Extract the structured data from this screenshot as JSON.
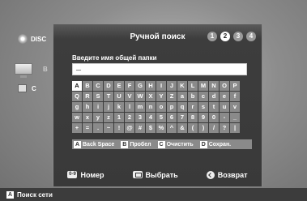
{
  "background": {
    "disc_label": "DISC",
    "pc_letter": "B",
    "item3_letter": "C"
  },
  "dialog": {
    "title": "Ручной поиск",
    "steps": [
      "1",
      "2",
      "3",
      "4"
    ],
    "active_step": "2",
    "prompt": "Введите имя общей папки",
    "input_value": "_",
    "selected_key": "A",
    "keyboard_rows": [
      [
        "A",
        "B",
        "C",
        "D",
        "E",
        "F",
        "G",
        "H",
        "I",
        "J",
        "K",
        "L",
        "M",
        "N",
        "O",
        "P"
      ],
      [
        "Q",
        "R",
        "S",
        "T",
        "U",
        "V",
        "W",
        "X",
        "Y",
        "Z",
        "a",
        "b",
        "c",
        "d",
        "e",
        "f"
      ],
      [
        "g",
        "h",
        "i",
        "j",
        "k",
        "l",
        "m",
        "n",
        "o",
        "p",
        "q",
        "r",
        "s",
        "t",
        "u",
        "v"
      ],
      [
        "w",
        "x",
        "y",
        "z",
        "1",
        "2",
        "3",
        "4",
        "5",
        "6",
        "7",
        "8",
        "9",
        "0",
        "-",
        "_"
      ],
      [
        "+",
        "=",
        ".",
        "~",
        "!",
        "@",
        "#",
        "$",
        "%",
        "^",
        "&",
        "(",
        ")",
        "/",
        "?",
        "|"
      ]
    ],
    "functions": [
      {
        "badge": "A",
        "label": "Back Space"
      },
      {
        "badge": "B",
        "label": "Пробел"
      },
      {
        "badge": "C",
        "label": "Очистить"
      },
      {
        "badge": "D",
        "label": "Сохран."
      }
    ],
    "bottom": {
      "number_icon_text": "0-9",
      "number_label": "Номер",
      "select_label": "Выбрать",
      "return_label": "Возврат"
    }
  },
  "status_bar": {
    "badge": "A",
    "label": "Поиск сети"
  },
  "colors": {
    "key_bg": "#8a8a8a",
    "key_selected": "#ffffff",
    "dialog_bg": "#3d3d3d"
  }
}
